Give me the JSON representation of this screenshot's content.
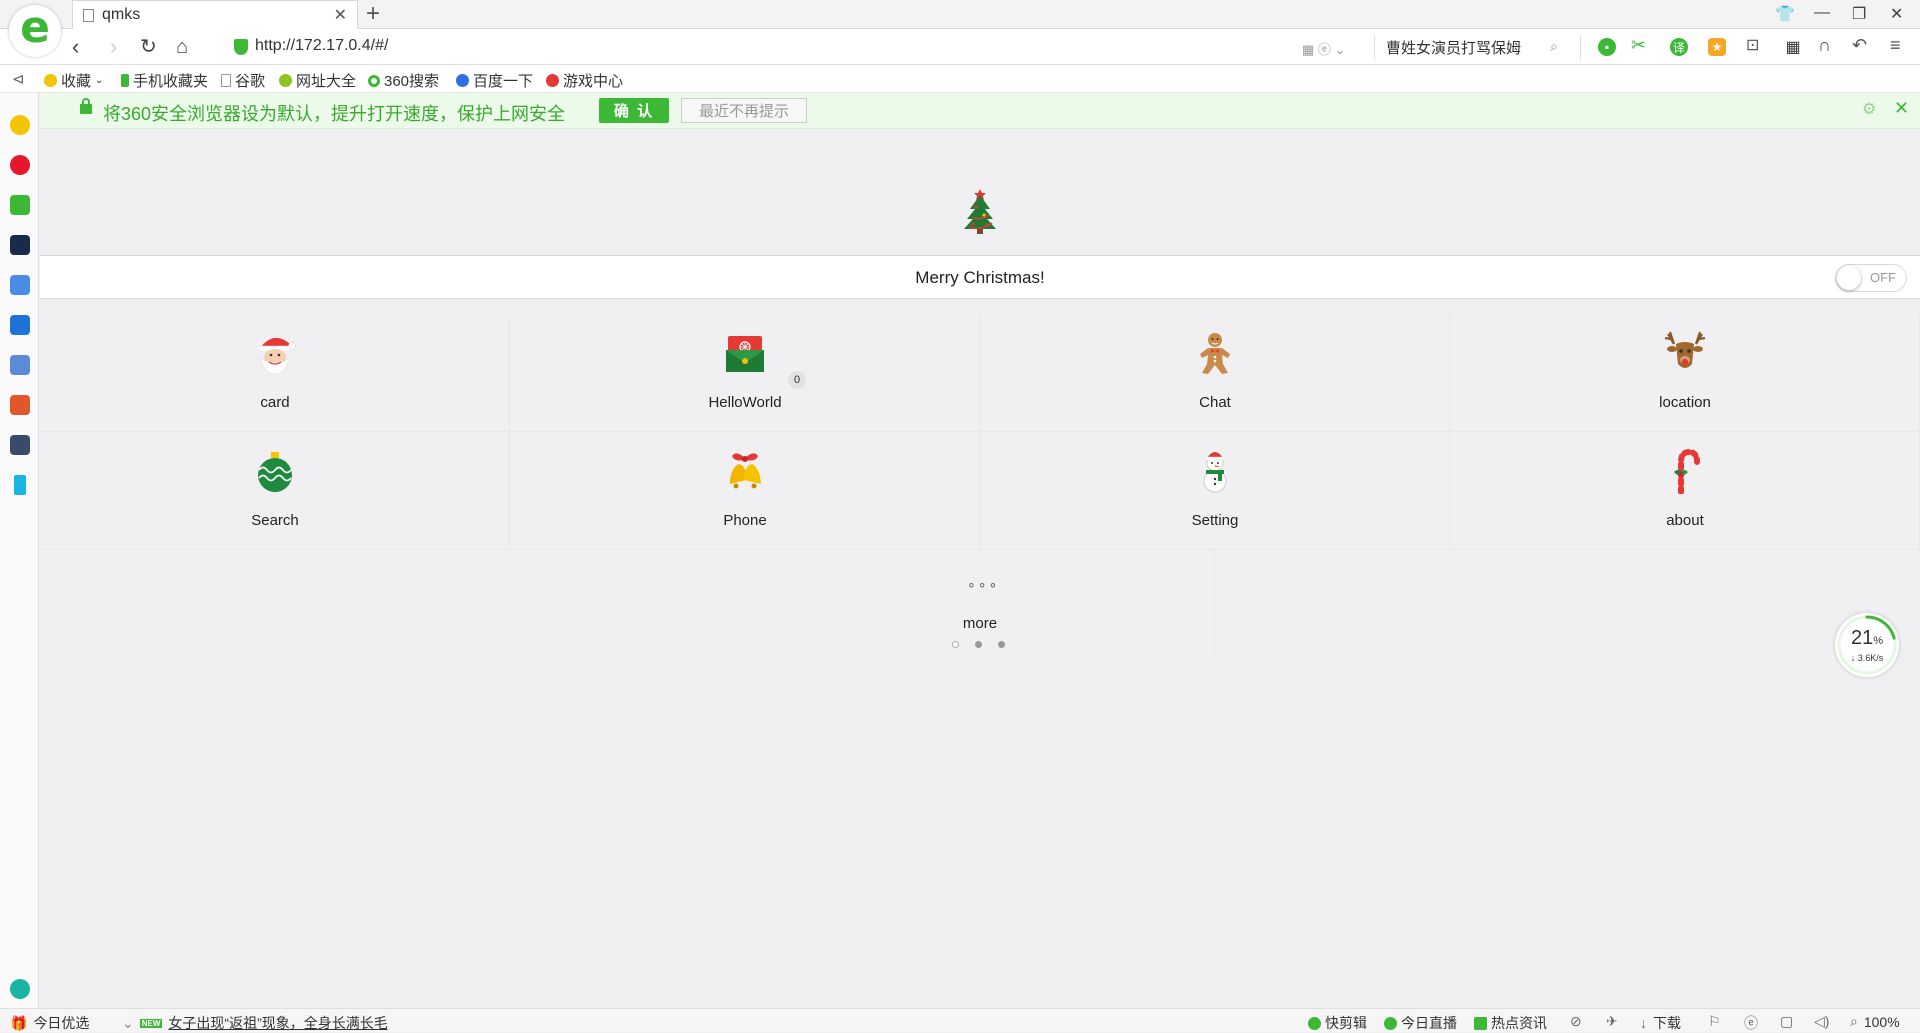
{
  "browser": {
    "tab_title": "qmks",
    "url": "http://172.17.0.4/#/",
    "search_text": "曹姓女演员打骂保姆"
  },
  "bookmarks": [
    {
      "label": "收藏",
      "icon": "star-icon"
    },
    {
      "label": "手机收藏夹",
      "icon": "phone-icon"
    },
    {
      "label": "谷歌",
      "icon": "doc-icon"
    },
    {
      "label": "网址大全",
      "icon": "globe-icon"
    },
    {
      "label": "360搜索",
      "icon": "360-icon"
    },
    {
      "label": "百度一下",
      "icon": "baidu-paw-icon"
    },
    {
      "label": "游戏中心",
      "icon": "game-icon"
    }
  ],
  "notification": {
    "text": "将360安全浏览器设为默认，提升打开速度，保护上网安全",
    "confirm_label": "确 认",
    "dismiss_label": "最近不再提示"
  },
  "page": {
    "banner_title": "Merry Christmas!",
    "toggle_label": "OFF",
    "toggle_on": false,
    "apps": [
      {
        "label": "card",
        "icon": "santa-icon"
      },
      {
        "label": "HelloWorld",
        "icon": "envelope-icon",
        "badge": "0"
      },
      {
        "label": "Chat",
        "icon": "gingerbread-icon"
      },
      {
        "label": "location",
        "icon": "reindeer-icon"
      },
      {
        "label": "Search",
        "icon": "ornament-icon"
      },
      {
        "label": "Phone",
        "icon": "bells-icon"
      },
      {
        "label": "Setting",
        "icon": "snowman-icon"
      },
      {
        "label": "about",
        "icon": "candy-cane-icon"
      }
    ],
    "more_label": "more",
    "pager_active": 2,
    "pager_count": 3
  },
  "speed_widget": {
    "percent": "21",
    "percent_unit": "%",
    "rate": "↓ 3.6K/s",
    "progress": 0.21
  },
  "statusbar": {
    "today_pick": "今日优选",
    "new_badge": "NEW",
    "headline": "女子出现“返祖”现象，全身长满长毛",
    "quick_cut": "快剪辑",
    "live": "今日直播",
    "hot_news": "热点资讯",
    "download": "下载",
    "zoom": "100%"
  },
  "colors": {
    "accent": "#3cb836",
    "notify_bg": "#ecfbe9"
  }
}
